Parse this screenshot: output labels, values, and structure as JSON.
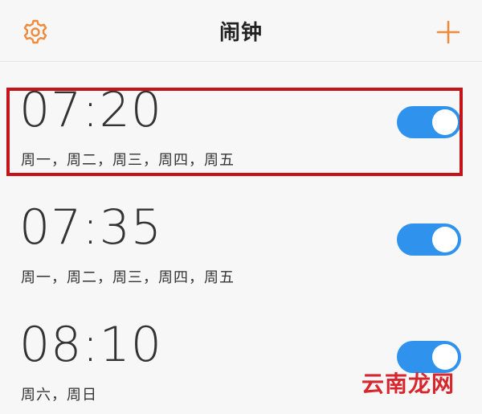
{
  "header": {
    "title": "闹钟",
    "settings_icon": "gear-icon",
    "add_icon": "plus-icon",
    "accent": "#f08a3c"
  },
  "alarms": [
    {
      "time": "07:20",
      "days": "周一，周二，周三，周四，周五",
      "enabled": true
    },
    {
      "time": "07:35",
      "days": "周一，周二，周三，周四，周五",
      "enabled": true
    },
    {
      "time": "08:10",
      "days": "周六，周日",
      "enabled": true
    }
  ],
  "colors": {
    "toggle_on": "#2f93ee",
    "highlight": "#c4141a"
  },
  "watermark": "云南龙网"
}
